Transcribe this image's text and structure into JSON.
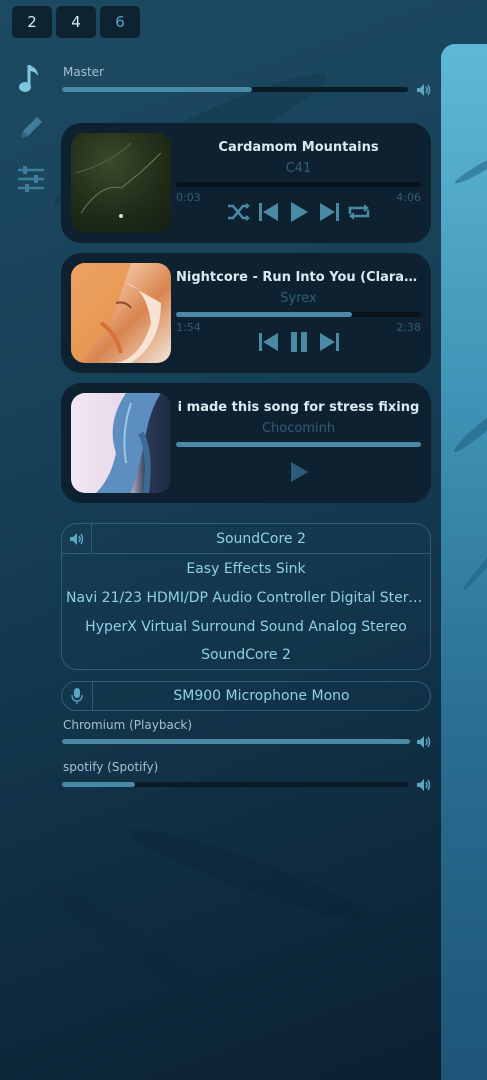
{
  "workspaces": [
    {
      "label": "2",
      "active": false
    },
    {
      "label": "4",
      "active": false
    },
    {
      "label": "6",
      "active": true
    }
  ],
  "sidebar": {
    "icons": [
      "music-note-icon",
      "pencil-icon",
      "sliders-icon"
    ]
  },
  "master": {
    "label": "Master",
    "volume_fraction": 0.55
  },
  "players": [
    {
      "title": "Cardamom Mountains",
      "artist": "C41",
      "position": "0:03",
      "length": "4:06",
      "progress_fraction": 0.0,
      "controls": [
        "shuffle",
        "previous",
        "play",
        "next",
        "repeat"
      ]
    },
    {
      "title": "Nightcore - Run Into You (Clara Mae...",
      "artist": "Syrex",
      "position": "1:54",
      "length": "2:38",
      "progress_fraction": 0.72,
      "controls": [
        "previous",
        "pause",
        "next"
      ]
    },
    {
      "title": "i made this song for stress fixing",
      "artist": "Chocominh",
      "position": "",
      "length": "",
      "progress_fraction": 1.0,
      "controls": [
        "play"
      ]
    }
  ],
  "output": {
    "selected": "SoundCore 2",
    "options": [
      "Easy Effects Sink",
      "Navi 21/23 HDMI/DP Audio Controller Digital Stereo (...",
      "HyperX Virtual Surround Sound Analog Stereo",
      "SoundCore 2"
    ]
  },
  "input": {
    "selected": "SM900 Microphone  Mono"
  },
  "streams": [
    {
      "label": "Chromium (Playback)",
      "volume_fraction": 1.0
    },
    {
      "label": "spotify (Spotify)",
      "volume_fraction": 0.21
    }
  ],
  "colors": {
    "accent": "#4a8aa5",
    "panel": "#0e2130",
    "text_accent": "#8fd0e6"
  }
}
